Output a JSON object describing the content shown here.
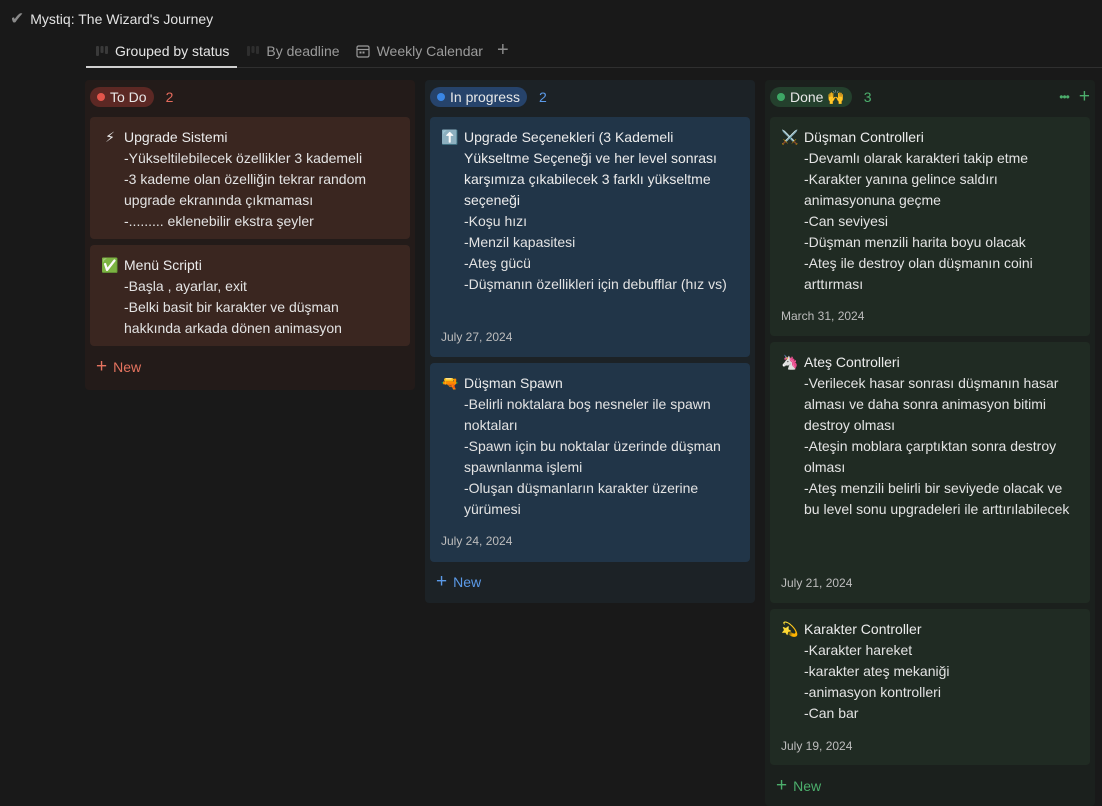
{
  "app": {
    "title": "Mystiq: The Wizard's Journey",
    "title_icon": "checkmark-icon"
  },
  "tabs": [
    {
      "label": "Grouped by status",
      "icon": "board-icon",
      "active": true
    },
    {
      "label": "By deadline",
      "icon": "board-icon",
      "active": false
    },
    {
      "label": "Weekly Calendar",
      "icon": "calendar-icon",
      "active": false
    }
  ],
  "add_tab": "+",
  "columns": {
    "todo": {
      "label": "To Do",
      "count": "2",
      "new_label": "New",
      "cards": [
        {
          "emoji": "⚡",
          "title": "Upgrade Sistemi",
          "lines": [
            "-Yükseltilebilecek özellikler 3 kademeli",
            "-3 kademe olan özelliğin tekrar random upgrade ekranında çıkmaması",
            "-......... eklenebilir ekstra şeyler"
          ]
        },
        {
          "emoji": "✅",
          "title": "Menü Scripti",
          "lines": [
            "-Başla , ayarlar, exit",
            "-Belki basit bir karakter ve düşman hakkında arkada dönen animasyon"
          ]
        }
      ]
    },
    "in_progress": {
      "label": "In progress",
      "count": "2",
      "new_label": "New",
      "cards": [
        {
          "emoji": "⬆️",
          "title": "Upgrade Seçenekleri (3 Kademeli Yükseltme Seçeneği ve her level sonrası karşımıza çıkabilecek 3 farklı yükseltme seçeneği",
          "lines": [
            "-Koşu hızı",
            "-Menzil kapasitesi",
            "-Ateş gücü",
            "-Düşmanın özellikleri için debufflar (hız vs)"
          ],
          "date": "July 27, 2024"
        },
        {
          "emoji": "🔫",
          "title": "Düşman Spawn",
          "lines": [
            "-Belirli noktalara boş nesneler ile spawn noktaları",
            "-Spawn için bu noktalar üzerinde düşman spawnlanma işlemi",
            "-Oluşan düşmanların karakter üzerine yürümesi"
          ],
          "date": "July 24, 2024"
        }
      ]
    },
    "done": {
      "label": "Done 🙌",
      "count": "3",
      "more_icon": "•••",
      "add_icon": "+",
      "new_label": "New",
      "cards": [
        {
          "emoji": "⚔️",
          "title": "Düşman Controlleri",
          "lines": [
            "-Devamlı olarak karakteri takip etme",
            "-Karakter yanına gelince saldırı animasyonuna geçme",
            "-Can seviyesi",
            "-Düşman menzili harita boyu olacak",
            "-Ateş ile destroy olan düşmanın coini arttırması"
          ],
          "date": "March 31, 2024"
        },
        {
          "emoji": "🦄",
          "title": "Ateş Controlleri",
          "lines": [
            "-Verilecek hasar sonrası düşmanın hasar alması ve daha sonra animasyon bitimi destroy olması",
            "-Ateşin moblara çarptıktan sonra destroy olması",
            "-Ateş menzili belirli bir seviyede olacak ve bu level sonu upgradeleri ile arttırılabilecek"
          ],
          "date": "July 21, 2024"
        },
        {
          "emoji": "💫",
          "title": "Karakter Controller",
          "lines": [
            "-Karakter hareket",
            "-karakter ateş mekaniği",
            "-animasyon kontrolleri",
            "-Can bar"
          ],
          "date": "July 19, 2024"
        }
      ]
    }
  }
}
